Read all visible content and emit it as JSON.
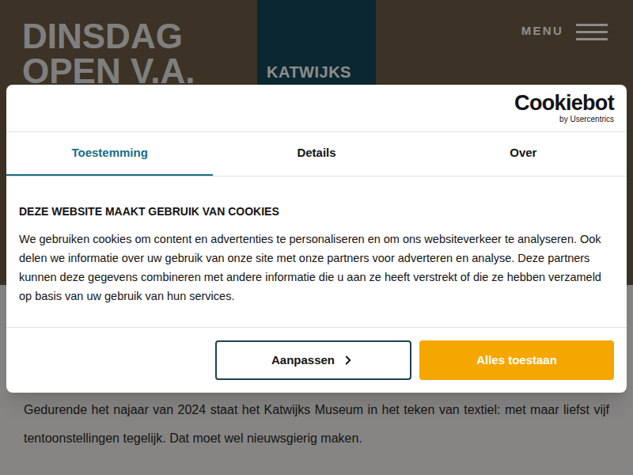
{
  "page": {
    "header_lines": [
      "DINSDAG",
      "OPEN V.A."
    ],
    "museum_label": "KATWIJKS",
    "menu": "MENU",
    "intro": "Gedurende het najaar van 2024 staat het Katwijks Museum in het teken van textiel: met maar liefst vijf tentoonstellingen tegelijk. Dat moet wel nieuwsgierig maken."
  },
  "dialog": {
    "logo": {
      "name": "Cookiebot",
      "byline": "by Usercentrics"
    },
    "tabs": [
      {
        "label": "Toestemming",
        "selected": true
      },
      {
        "label": "Details",
        "selected": false
      },
      {
        "label": "Over",
        "selected": false
      }
    ],
    "title": "DEZE WEBSITE MAAKT GEBRUIK VAN COOKIES",
    "body": "We gebruiken cookies om content en advertenties te personaliseren en om ons websiteverkeer te analyseren. Ook delen we informatie over uw gebruik van onze site met onze partners voor adverteren en analyse. Deze partners kunnen deze gegevens combineren met andere informatie die u aan ze heeft verstrekt of die ze hebben verzameld op basis van uw gebruik van hun services.",
    "buttons": [
      {
        "label": "Aanpassen",
        "kind": "outline"
      },
      {
        "label": "Alles toestaan",
        "kind": "primary"
      }
    ]
  }
}
